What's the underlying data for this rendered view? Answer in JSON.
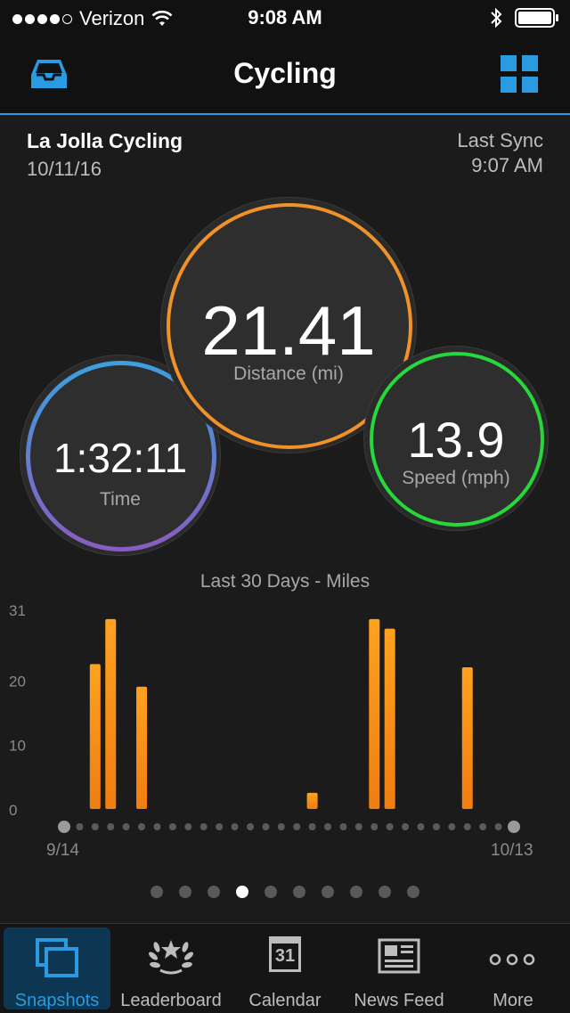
{
  "status_bar": {
    "carrier": "Verizon",
    "time": "9:08 AM"
  },
  "nav": {
    "title": "Cycling"
  },
  "activity": {
    "name": "La Jolla Cycling",
    "date": "10/11/16",
    "sync_label": "Last Sync",
    "sync_time": "9:07 AM"
  },
  "metrics": {
    "distance": {
      "value": "21.41",
      "label": "Distance (mi)"
    },
    "time": {
      "value": "1:32:11",
      "label": "Time"
    },
    "speed": {
      "value": "13.9",
      "label": "Speed (mph)"
    }
  },
  "colors": {
    "accent": "#2a9be0",
    "distance_ring": "#f0922a",
    "speed_ring": "#27d83a",
    "bar": "#f7941d"
  },
  "chart_data": {
    "type": "bar",
    "title": "Last 30 Days - Miles",
    "x_labels": [
      "9/14",
      "10/13"
    ],
    "y_ticks": [
      0,
      10,
      20,
      31
    ],
    "ylim": [
      0,
      31
    ],
    "days": 30,
    "values": [
      0,
      0,
      22.5,
      29.5,
      0,
      19,
      0,
      0,
      0,
      0,
      0,
      0,
      0,
      0,
      0,
      0,
      2.5,
      0,
      0,
      0,
      29.5,
      28,
      0,
      0,
      0,
      0,
      22,
      0,
      0,
      0
    ]
  },
  "pager": {
    "count": 10,
    "active_index": 3
  },
  "tabs": [
    {
      "label": "Snapshots",
      "icon": "snapshots-icon"
    },
    {
      "label": "Leaderboard",
      "icon": "laurel-icon"
    },
    {
      "label": "Calendar",
      "icon": "calendar-icon",
      "icon_text": "31"
    },
    {
      "label": "News Feed",
      "icon": "newspaper-icon"
    },
    {
      "label": "More",
      "icon": "more-icon"
    }
  ]
}
